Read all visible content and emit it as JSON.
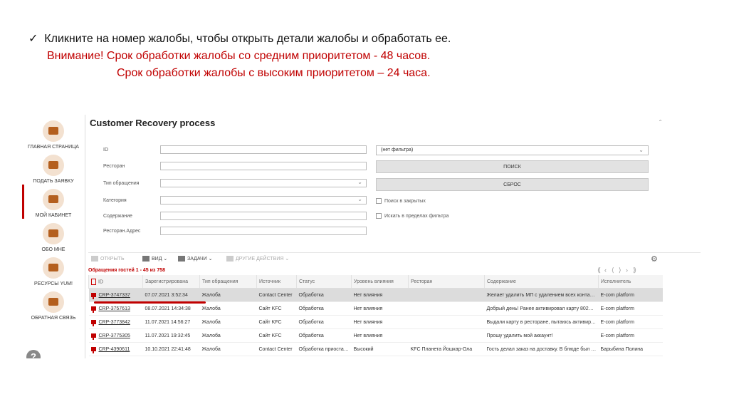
{
  "slide": {
    "check": "✓",
    "line1": "Кликните на номер жалобы, чтобы открыть детали жалобы и обработать ее.",
    "line2": "Внимание! Срок обработки жалобы со средним приоритетом - 48 часов.",
    "line3": "Срок обработки жалобы с высоким приоритетом – 24 часа."
  },
  "sidebar": {
    "items": [
      {
        "label": "ГЛАВНАЯ СТРАНИЦА",
        "icon": "monitor-icon"
      },
      {
        "label": "ПОДАТЬ ЗАЯВКУ",
        "icon": "phone-icon"
      },
      {
        "label": "МОЙ КАБИНЕТ",
        "icon": "cabinet-icon"
      },
      {
        "label": "ОБО МНЕ",
        "icon": "profile-icon"
      },
      {
        "label": "РЕСУРСЫ YUM!",
        "icon": "network-icon"
      },
      {
        "label": "ОБРАТНАЯ СВЯЗЬ",
        "icon": "feedback-icon"
      }
    ],
    "help": "?"
  },
  "page": {
    "title": "Customer Recovery process",
    "collapse": "⌃"
  },
  "filters": {
    "id_label": "ID",
    "restaurant_label": "Ресторан",
    "type_label": "Тип обращения",
    "category_label": "Категория",
    "content_label": "Содержание",
    "address_label": "Ресторан.Адрес",
    "filter_select": "(нет фильтра)",
    "search_btn": "ПОИСК",
    "reset_btn": "СБРОС",
    "chk_closed": "Поиск в закрытых",
    "chk_in_filter": "Искать в пределах фильтра"
  },
  "toolbar": {
    "open": "ОТКРЫТЬ",
    "view": "ВИД",
    "tasks": "ЗАДАЧИ",
    "other": "ДРУГИЕ ДЕЙСТВИЯ"
  },
  "list": {
    "count": "Обращения гостей 1 - 45 из 758",
    "pager": [
      "⟪",
      "‹",
      "⟨",
      "⟩",
      "›",
      "⟫"
    ],
    "columns": [
      "ID",
      "Зарегистрирована",
      "Тип обращения",
      "Источник",
      "Статус",
      "Уровень влияния",
      "Ресторан",
      "Содержание",
      "Исполнитель"
    ],
    "rows": [
      [
        "CRP-3747337",
        "07.07.2021 3:52:34",
        "Жалоба",
        "Contact Center",
        "Обработка",
        "Нет влияния",
        "",
        "Желает удалить МП с удалением всех контакт...",
        "E-com platform"
      ],
      [
        "CRP-3757613",
        "08.07.2021 14:34:38",
        "Жалоба",
        "Сайт KFC",
        "Обработка",
        "Нет влияния",
        "",
        "Добрый день! Ранее активировал карту 80209...",
        "E-com platform"
      ],
      [
        "CRP-3773842",
        "11.07.2021 14:56:27",
        "Жалоба",
        "Сайт KFC",
        "Обработка",
        "Нет влияния",
        "",
        "Выдали карту в ресторане, пытаюсь активиро...",
        "E-com platform"
      ],
      [
        "CRP-3775305",
        "11.07.2021 19:32:45",
        "Жалоба",
        "Сайт KFC",
        "Обработка",
        "Нет влияния",
        "",
        "Прошу удалить мой аккаунт!",
        "E-com platform"
      ],
      [
        "CRP-4390611",
        "10.10.2021 22:41:48",
        "Жалоба",
        "Contact Center",
        "Обработка приостан...",
        "Высокий",
        "KFC Планета Йошкар-Ола",
        "Гость делал заказ на доставку. В блюде был к...",
        "Барыбина Полина"
      ]
    ]
  }
}
